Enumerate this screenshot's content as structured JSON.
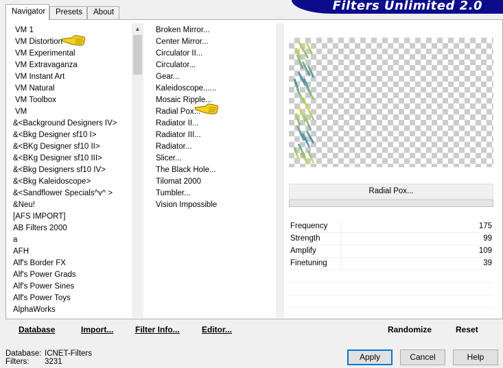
{
  "title_banner": "Filters Unlimited 2.0",
  "tabs": [
    {
      "label": "Navigator"
    },
    {
      "label": "Presets"
    },
    {
      "label": "About"
    }
  ],
  "categories": [
    "VM 1",
    "VM Distortion",
    "VM Experimental",
    "VM Extravaganza",
    "VM Instant Art",
    "VM Natural",
    "VM Toolbox",
    "VM",
    "&<Background Designers IV>",
    "&<Bkg Designer sf10 I>",
    "&<BKg Designer sf10 II>",
    "&<BKg Designer sf10 III>",
    "&<Bkg Designers sf10 IV>",
    "&<Bkg Kaleidoscope>",
    "&<Sandflower Specials^v^ >",
    "&Neu!",
    "[AFS IMPORT]",
    "AB Filters 2000",
    "a",
    "AFH",
    "Alf's Border FX",
    "Alf's Power Grads",
    "Alf's Power Sines",
    "Alf's Power Toys",
    "AlphaWorks"
  ],
  "selected_category": "VM Distortion",
  "filters": [
    "Broken Mirror...",
    "Center Mirror...",
    "Circulator II...",
    "Circulator...",
    "Gear...",
    "Kaleidoscope......",
    "Mosaic Ripple...",
    "Radial Pox...",
    "Radiator II...",
    "Radiator III...",
    "Radiator...",
    "Slicer...",
    "The Black Hole...",
    "Tilomat 2000",
    "Tumbler...",
    "Vision Impossible"
  ],
  "selected_filter": "Radial Pox...",
  "current_filter_name": "Radial Pox...",
  "parameters": [
    {
      "label": "Frequency",
      "value": "175"
    },
    {
      "label": "Strength",
      "value": "99"
    },
    {
      "label": "Amplify",
      "value": "109"
    },
    {
      "label": "Finetuning",
      "value": "39"
    }
  ],
  "toolbar": {
    "database": "Database",
    "import": "Import...",
    "filter_info": "Filter Info...",
    "editor": "Editor...",
    "randomize": "Randomize",
    "reset": "Reset"
  },
  "status": {
    "database_label": "Database:",
    "database_value": "ICNET-Filters",
    "filters_label": "Filters:",
    "filters_value": "3231"
  },
  "buttons": {
    "apply": "Apply",
    "cancel": "Cancel",
    "help": "Help"
  },
  "colors": {
    "banner": "#0b0b8c",
    "primary_button_border": "#0078d7"
  }
}
